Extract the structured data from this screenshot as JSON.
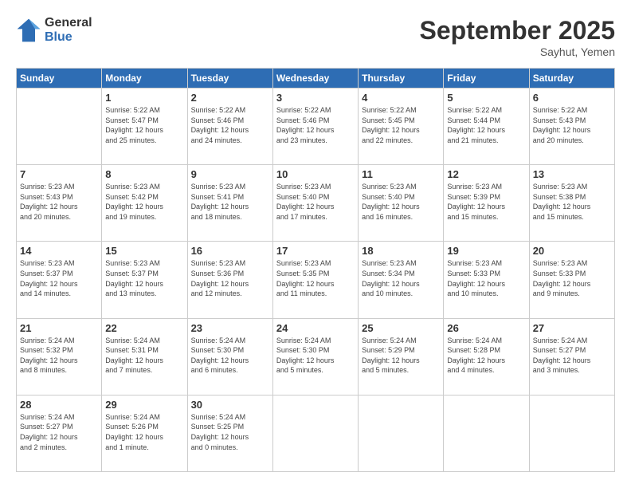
{
  "header": {
    "logo_line1": "General",
    "logo_line2": "Blue",
    "title": "September 2025",
    "subtitle": "Sayhut, Yemen"
  },
  "days_of_week": [
    "Sunday",
    "Monday",
    "Tuesday",
    "Wednesday",
    "Thursday",
    "Friday",
    "Saturday"
  ],
  "weeks": [
    [
      {
        "day": "",
        "info": ""
      },
      {
        "day": "1",
        "info": "Sunrise: 5:22 AM\nSunset: 5:47 PM\nDaylight: 12 hours\nand 25 minutes."
      },
      {
        "day": "2",
        "info": "Sunrise: 5:22 AM\nSunset: 5:46 PM\nDaylight: 12 hours\nand 24 minutes."
      },
      {
        "day": "3",
        "info": "Sunrise: 5:22 AM\nSunset: 5:46 PM\nDaylight: 12 hours\nand 23 minutes."
      },
      {
        "day": "4",
        "info": "Sunrise: 5:22 AM\nSunset: 5:45 PM\nDaylight: 12 hours\nand 22 minutes."
      },
      {
        "day": "5",
        "info": "Sunrise: 5:22 AM\nSunset: 5:44 PM\nDaylight: 12 hours\nand 21 minutes."
      },
      {
        "day": "6",
        "info": "Sunrise: 5:22 AM\nSunset: 5:43 PM\nDaylight: 12 hours\nand 20 minutes."
      }
    ],
    [
      {
        "day": "7",
        "info": "Sunrise: 5:23 AM\nSunset: 5:43 PM\nDaylight: 12 hours\nand 20 minutes."
      },
      {
        "day": "8",
        "info": "Sunrise: 5:23 AM\nSunset: 5:42 PM\nDaylight: 12 hours\nand 19 minutes."
      },
      {
        "day": "9",
        "info": "Sunrise: 5:23 AM\nSunset: 5:41 PM\nDaylight: 12 hours\nand 18 minutes."
      },
      {
        "day": "10",
        "info": "Sunrise: 5:23 AM\nSunset: 5:40 PM\nDaylight: 12 hours\nand 17 minutes."
      },
      {
        "day": "11",
        "info": "Sunrise: 5:23 AM\nSunset: 5:40 PM\nDaylight: 12 hours\nand 16 minutes."
      },
      {
        "day": "12",
        "info": "Sunrise: 5:23 AM\nSunset: 5:39 PM\nDaylight: 12 hours\nand 15 minutes."
      },
      {
        "day": "13",
        "info": "Sunrise: 5:23 AM\nSunset: 5:38 PM\nDaylight: 12 hours\nand 15 minutes."
      }
    ],
    [
      {
        "day": "14",
        "info": "Sunrise: 5:23 AM\nSunset: 5:37 PM\nDaylight: 12 hours\nand 14 minutes."
      },
      {
        "day": "15",
        "info": "Sunrise: 5:23 AM\nSunset: 5:37 PM\nDaylight: 12 hours\nand 13 minutes."
      },
      {
        "day": "16",
        "info": "Sunrise: 5:23 AM\nSunset: 5:36 PM\nDaylight: 12 hours\nand 12 minutes."
      },
      {
        "day": "17",
        "info": "Sunrise: 5:23 AM\nSunset: 5:35 PM\nDaylight: 12 hours\nand 11 minutes."
      },
      {
        "day": "18",
        "info": "Sunrise: 5:23 AM\nSunset: 5:34 PM\nDaylight: 12 hours\nand 10 minutes."
      },
      {
        "day": "19",
        "info": "Sunrise: 5:23 AM\nSunset: 5:33 PM\nDaylight: 12 hours\nand 10 minutes."
      },
      {
        "day": "20",
        "info": "Sunrise: 5:23 AM\nSunset: 5:33 PM\nDaylight: 12 hours\nand 9 minutes."
      }
    ],
    [
      {
        "day": "21",
        "info": "Sunrise: 5:24 AM\nSunset: 5:32 PM\nDaylight: 12 hours\nand 8 minutes."
      },
      {
        "day": "22",
        "info": "Sunrise: 5:24 AM\nSunset: 5:31 PM\nDaylight: 12 hours\nand 7 minutes."
      },
      {
        "day": "23",
        "info": "Sunrise: 5:24 AM\nSunset: 5:30 PM\nDaylight: 12 hours\nand 6 minutes."
      },
      {
        "day": "24",
        "info": "Sunrise: 5:24 AM\nSunset: 5:30 PM\nDaylight: 12 hours\nand 5 minutes."
      },
      {
        "day": "25",
        "info": "Sunrise: 5:24 AM\nSunset: 5:29 PM\nDaylight: 12 hours\nand 5 minutes."
      },
      {
        "day": "26",
        "info": "Sunrise: 5:24 AM\nSunset: 5:28 PM\nDaylight: 12 hours\nand 4 minutes."
      },
      {
        "day": "27",
        "info": "Sunrise: 5:24 AM\nSunset: 5:27 PM\nDaylight: 12 hours\nand 3 minutes."
      }
    ],
    [
      {
        "day": "28",
        "info": "Sunrise: 5:24 AM\nSunset: 5:27 PM\nDaylight: 12 hours\nand 2 minutes."
      },
      {
        "day": "29",
        "info": "Sunrise: 5:24 AM\nSunset: 5:26 PM\nDaylight: 12 hours\nand 1 minute."
      },
      {
        "day": "30",
        "info": "Sunrise: 5:24 AM\nSunset: 5:25 PM\nDaylight: 12 hours\nand 0 minutes."
      },
      {
        "day": "",
        "info": ""
      },
      {
        "day": "",
        "info": ""
      },
      {
        "day": "",
        "info": ""
      },
      {
        "day": "",
        "info": ""
      }
    ]
  ]
}
